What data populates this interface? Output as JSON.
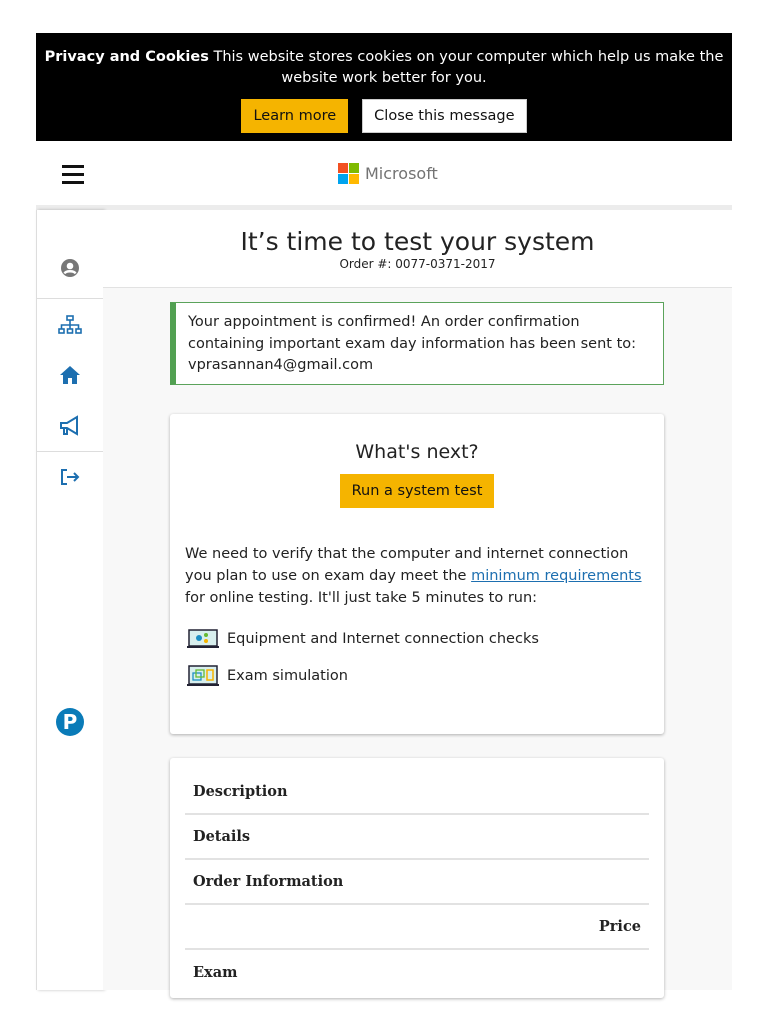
{
  "cookie": {
    "title": "Privacy and Cookies",
    "text": "This website stores cookies on your computer which help us make the website work better for you.",
    "learn_more": "Learn more",
    "close": "Close this message"
  },
  "header": {
    "brand": "Microsoft"
  },
  "main": {
    "title": "It’s time to test your system",
    "order": "Order #: 0077-0371-2017",
    "alert": "Your appointment is confirmed! An order confirmation containing important exam day information has been sent to: vprasannan4@gmail.com",
    "next": {
      "heading": "What's next?",
      "run_button": "Run a system test",
      "text_before": "We need to verify that the computer and internet connection you plan to use on exam day meet the ",
      "link": "minimum requirements",
      "text_after": " for online testing. It'll just take 5 minutes to run:",
      "checks": [
        "Equipment and Internet connection checks",
        "Exam simulation"
      ]
    },
    "order_rows": [
      "Description",
      "Details",
      "Order Information",
      "Price",
      "Exam"
    ]
  },
  "colors": {
    "accent": "#f5b400",
    "link": "#1d6fb0",
    "success": "#52a052"
  }
}
